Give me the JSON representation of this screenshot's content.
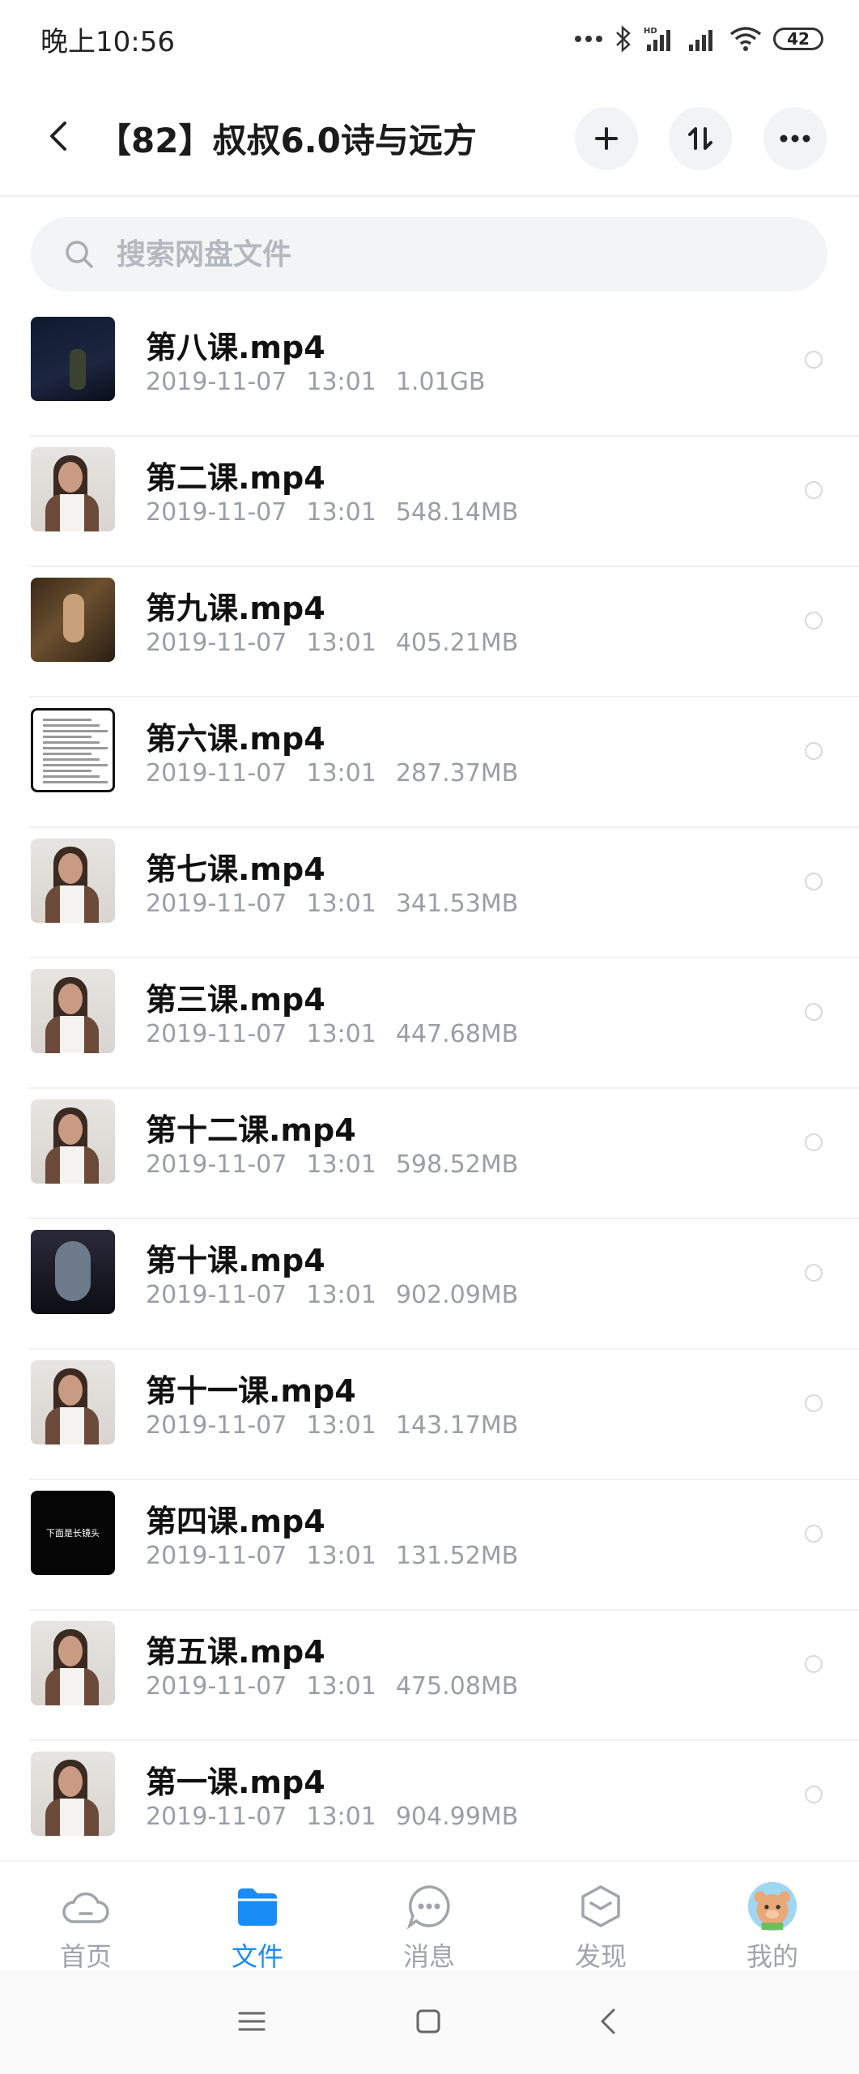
{
  "status_bar": {
    "time": "晚上10:56",
    "battery": "42"
  },
  "header": {
    "title": "【82】叔叔6.0诗与远方"
  },
  "search": {
    "placeholder": "搜索网盘文件"
  },
  "files": [
    {
      "name": "第八课.mp4",
      "date": "2019-11-07",
      "time": "13:01",
      "size": "1.01GB",
      "thumb": "dark"
    },
    {
      "name": "第二课.mp4",
      "date": "2019-11-07",
      "time": "13:01",
      "size": "548.14MB",
      "thumb": "person"
    },
    {
      "name": "第九课.mp4",
      "date": "2019-11-07",
      "time": "13:01",
      "size": "405.21MB",
      "thumb": "painting"
    },
    {
      "name": "第六课.mp4",
      "date": "2019-11-07",
      "time": "13:01",
      "size": "287.37MB",
      "thumb": "doc"
    },
    {
      "name": "第七课.mp4",
      "date": "2019-11-07",
      "time": "13:01",
      "size": "341.53MB",
      "thumb": "person"
    },
    {
      "name": "第三课.mp4",
      "date": "2019-11-07",
      "time": "13:01",
      "size": "447.68MB",
      "thumb": "person"
    },
    {
      "name": "第十二课.mp4",
      "date": "2019-11-07",
      "time": "13:01",
      "size": "598.52MB",
      "thumb": "person"
    },
    {
      "name": "第十课.mp4",
      "date": "2019-11-07",
      "time": "13:01",
      "size": "902.09MB",
      "thumb": "portrait"
    },
    {
      "name": "第十一课.mp4",
      "date": "2019-11-07",
      "time": "13:01",
      "size": "143.17MB",
      "thumb": "person"
    },
    {
      "name": "第四课.mp4",
      "date": "2019-11-07",
      "time": "13:01",
      "size": "131.52MB",
      "thumb": "black",
      "thumb_text": "下面是长镜头"
    },
    {
      "name": "第五课.mp4",
      "date": "2019-11-07",
      "time": "13:01",
      "size": "475.08MB",
      "thumb": "person"
    },
    {
      "name": "第一课.mp4",
      "date": "2019-11-07",
      "time": "13:01",
      "size": "904.99MB",
      "thumb": "person"
    }
  ],
  "bottom_nav": [
    {
      "label": "首页",
      "icon": "cloud-icon",
      "active": false
    },
    {
      "label": "文件",
      "icon": "folder-icon",
      "active": true
    },
    {
      "label": "消息",
      "icon": "chat-icon",
      "active": false
    },
    {
      "label": "发现",
      "icon": "cube-icon",
      "active": false
    },
    {
      "label": "我的",
      "icon": "avatar-icon",
      "active": false
    }
  ],
  "colors": {
    "accent": "#1a8cf5",
    "meta_text": "#9a9ea5",
    "nav_inactive": "#a0a4ab"
  }
}
